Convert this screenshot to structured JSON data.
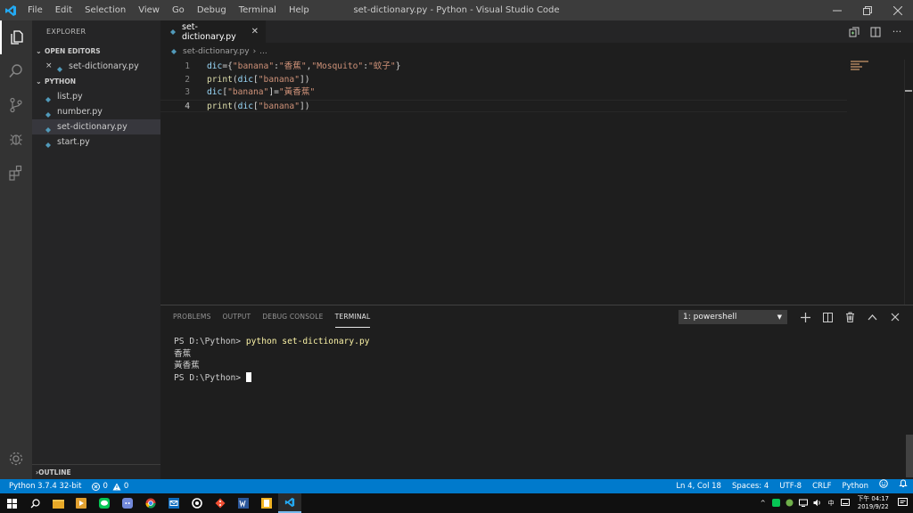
{
  "titlebar": {
    "menus": [
      "File",
      "Edit",
      "Selection",
      "View",
      "Go",
      "Debug",
      "Terminal",
      "Help"
    ],
    "title": "set-dictionary.py - Python - Visual Studio Code"
  },
  "sidebar": {
    "title": "EXPLORER",
    "open_editors_label": "OPEN EDITORS",
    "open_editors": [
      {
        "name": "set-dictionary.py"
      }
    ],
    "folder_label": "PYTHON",
    "files": [
      "list.py",
      "number.py",
      "set-dictionary.py",
      "start.py"
    ],
    "selected_file": "set-dictionary.py",
    "outline_label": "OUTLINE"
  },
  "editor": {
    "active_tab": "set-dictionary.py",
    "breadcrumb": {
      "file": "set-dictionary.py",
      "rest": "..."
    },
    "current_line": 4,
    "lines": [
      {
        "number": "1",
        "tokens": [
          {
            "t": "dic",
            "c": "var"
          },
          {
            "t": "={",
            "c": "p"
          },
          {
            "t": "\"banana\"",
            "c": "str"
          },
          {
            "t": ":",
            "c": "p"
          },
          {
            "t": "\"香蕉\"",
            "c": "str"
          },
          {
            "t": ",",
            "c": "p"
          },
          {
            "t": "\"Mosquito\"",
            "c": "str"
          },
          {
            "t": ":",
            "c": "p"
          },
          {
            "t": "\"蚊子\"",
            "c": "str"
          },
          {
            "t": "}",
            "c": "p"
          }
        ]
      },
      {
        "number": "2",
        "tokens": [
          {
            "t": "print",
            "c": "fn"
          },
          {
            "t": "(",
            "c": "p"
          },
          {
            "t": "dic",
            "c": "var"
          },
          {
            "t": "[",
            "c": "p"
          },
          {
            "t": "\"banana\"",
            "c": "str"
          },
          {
            "t": "])",
            "c": "p"
          }
        ]
      },
      {
        "number": "3",
        "tokens": [
          {
            "t": "dic",
            "c": "var"
          },
          {
            "t": "[",
            "c": "p"
          },
          {
            "t": "\"banana\"",
            "c": "str"
          },
          {
            "t": "]=",
            "c": "p"
          },
          {
            "t": "\"黃香蕉\"",
            "c": "str"
          }
        ]
      },
      {
        "number": "4",
        "tokens": [
          {
            "t": "print",
            "c": "fn"
          },
          {
            "t": "(",
            "c": "p"
          },
          {
            "t": "dic",
            "c": "var"
          },
          {
            "t": "[",
            "c": "p"
          },
          {
            "t": "\"banana\"",
            "c": "str"
          },
          {
            "t": "])",
            "c": "p"
          }
        ]
      }
    ]
  },
  "panel": {
    "tabs": [
      "PROBLEMS",
      "OUTPUT",
      "DEBUG CONSOLE",
      "TERMINAL"
    ],
    "active_tab": "TERMINAL",
    "terminal_selector": "1: powershell",
    "terminal": {
      "prompt": "PS D:\\Python> ",
      "command": "python set-dictionary.py",
      "output": [
        "香蕉",
        "黃香蕉"
      ],
      "final_prompt": "PS D:\\Python> "
    }
  },
  "statusbar": {
    "interpreter": "Python 3.7.4 32-bit",
    "errors": "0",
    "warnings": "0",
    "position": "Ln 4, Col 18",
    "spaces": "Spaces: 4",
    "encoding": "UTF-8",
    "eol": "CRLF",
    "language": "Python"
  },
  "taskbar": {
    "time": "04:17",
    "time_prefix": "下午",
    "date": "2019/9/22",
    "ime": "中"
  },
  "colors": {
    "accent": "#007acc",
    "editor_bg": "#1e1e1e",
    "sidebar_bg": "#252526",
    "string": "#ce9178",
    "function": "#dcdcaa",
    "variable": "#9cdcfe"
  }
}
